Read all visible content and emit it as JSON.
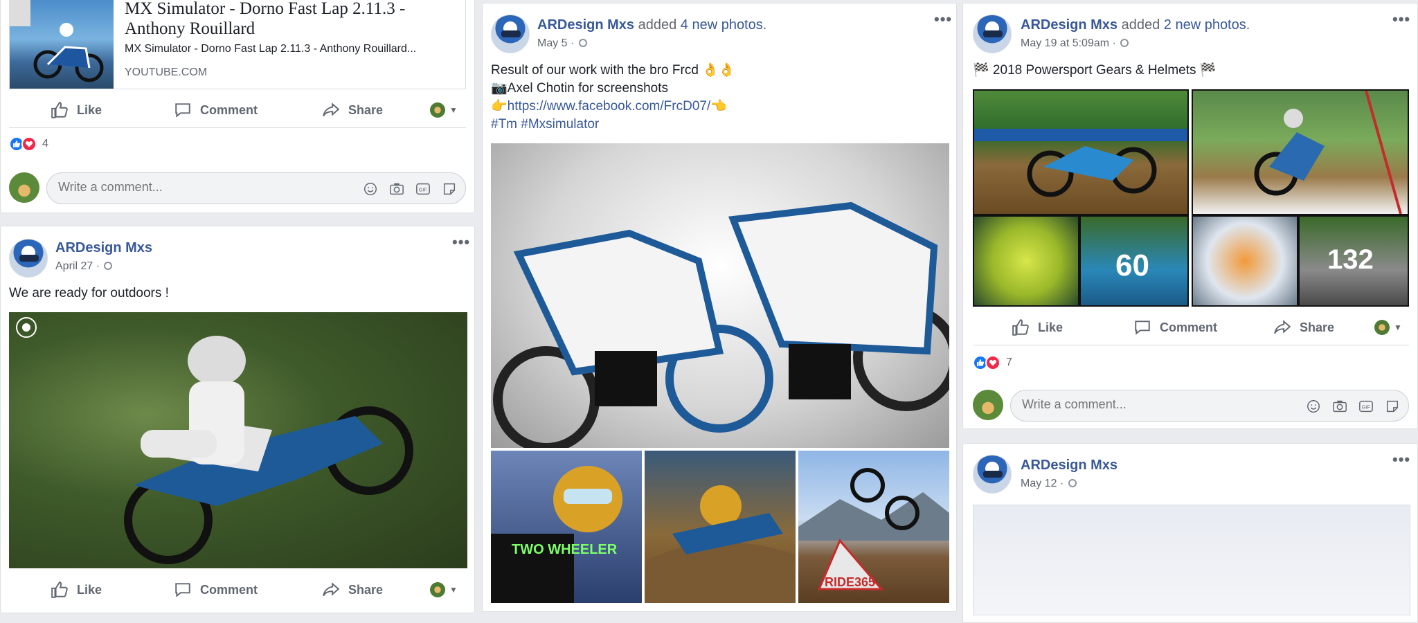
{
  "colors": {
    "link": "#385898",
    "meta": "#616770",
    "like_blue": "#1877f2",
    "love_red": "#f0284a",
    "page_bg": "#e9ebee"
  },
  "actions": {
    "like": "Like",
    "comment": "Comment",
    "share": "Share"
  },
  "comment_placeholder": "Write a comment...",
  "col1": {
    "link_card": {
      "title_line1": "MX Simulator - Dorno Fast Lap 2.11.3 -",
      "title_line2": "Anthony Rouillard",
      "description": "MX Simulator - Dorno Fast Lap 2.11.3 - Anthony Rouillard...",
      "domain": "YOUTUBE.COM"
    },
    "reaction_count": "4",
    "post": {
      "author": "ARDesign Mxs",
      "date": "April 27 ·",
      "text": "We are ready for outdoors !"
    }
  },
  "col2": {
    "post": {
      "author": "ARDesign Mxs",
      "added_prefix": "added ",
      "added_count": "4 new photos",
      "added_suffix": ".",
      "date": "May 5 ·",
      "line1": "Result of our work with the bro Frcd 👌👌",
      "line2": "📷Axel Chotin for screenshots",
      "line3_prefix": "👉",
      "line3_link": "https://www.facebook.com/FrcD07/",
      "line3_suffix": "👈",
      "line4": "#Tm #Mxsimulator",
      "photo_text_1": "TWO WHEELER",
      "photo_text_3": "RIDE365"
    }
  },
  "col3": {
    "post1": {
      "author": "ARDesign Mxs",
      "added_prefix": "added ",
      "added_count": "2 new photos",
      "added_suffix": ".",
      "date": "May 19 at 5:09am ·",
      "text": "🏁 2018 Powersport Gears & Helmets 🏁",
      "number_60": "60",
      "number_132": "132"
    },
    "reaction_count": "7",
    "post2": {
      "author": "ARDesign Mxs",
      "date": "May 12 ·"
    }
  }
}
